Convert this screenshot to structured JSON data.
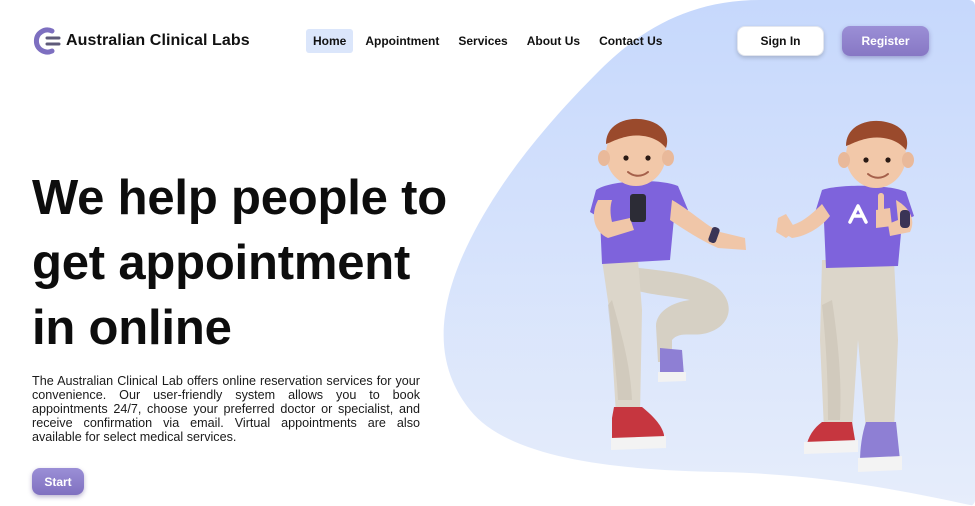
{
  "brand": {
    "name": "Australian Clinical Labs",
    "logo_icon": "ac-monogram-icon"
  },
  "nav": {
    "items": [
      {
        "label": "Home",
        "active": true
      },
      {
        "label": "Appointment",
        "active": false
      },
      {
        "label": "Services",
        "active": false
      },
      {
        "label": "About Us",
        "active": false
      },
      {
        "label": "Contact Us",
        "active": false
      }
    ]
  },
  "auth": {
    "signin_label": "Sign In",
    "register_label": "Register"
  },
  "hero": {
    "headline_line1": "We help people to",
    "headline_line2": "get appointment",
    "headline_line3": "in online",
    "description": "The Australian Clinical Lab offers online reservation services for your convenience. Our user-friendly system allows you to book appointments 24/7, choose your preferred doctor or specialist, and receive confirmation via email. Virtual appointments are also available for select medical services.",
    "start_label": "Start"
  },
  "colors": {
    "accent": "#8b7cc8",
    "nav_active_bg": "#dbe6fb",
    "blob_top": "#c7d8fb",
    "blob_bottom": "#e4ecfb"
  }
}
